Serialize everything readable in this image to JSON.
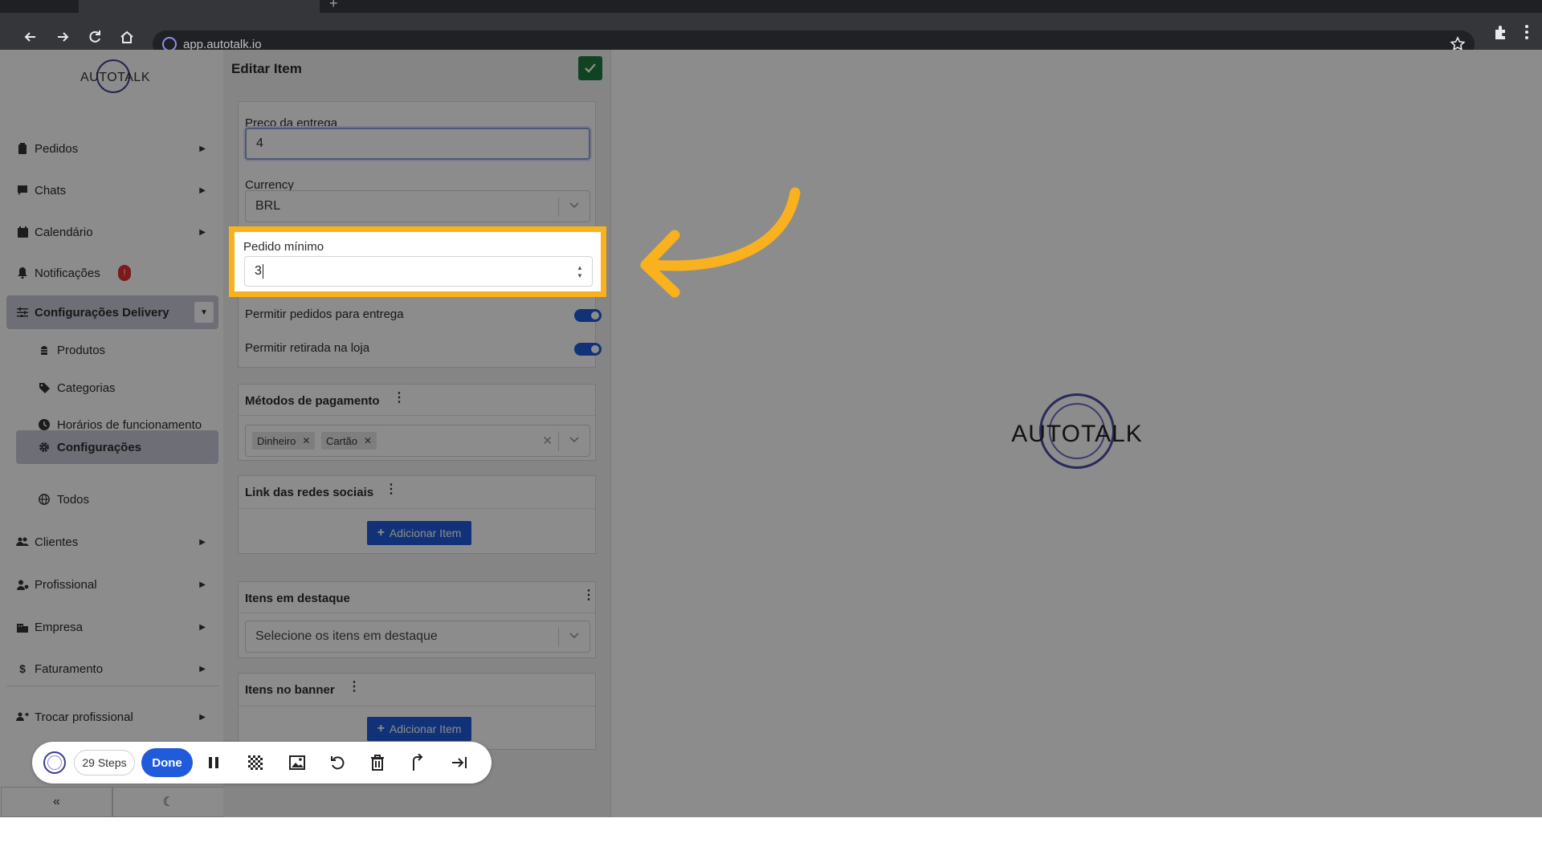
{
  "browser": {
    "url": "app.autotalk.io",
    "tab_add": "+"
  },
  "sidebar": {
    "logo_text": "AUTOTALK",
    "items": [
      {
        "label": "Pedidos",
        "icon": "clipboard-icon"
      },
      {
        "label": "Chats",
        "icon": "chat-icon"
      },
      {
        "label": "Calendário",
        "icon": "calendar-icon"
      },
      {
        "label": "Notificações",
        "icon": "bell-icon",
        "badge": "!"
      },
      {
        "label": "Configurações Delivery",
        "icon": "sliders-icon"
      },
      {
        "label": "Clientes",
        "icon": "users-icon"
      },
      {
        "label": "Profissional",
        "icon": "user-gear-icon"
      },
      {
        "label": "Empresa",
        "icon": "building-icon"
      },
      {
        "label": "Faturamento",
        "icon": "dollar-icon"
      },
      {
        "label": "Trocar profissional",
        "icon": "users-swap-icon"
      }
    ],
    "subitems": [
      {
        "label": "Produtos",
        "icon": "hamburger-icon"
      },
      {
        "label": "Categorias",
        "icon": "tag-icon"
      },
      {
        "label": "Horários de funcionamento",
        "icon": "clock-icon"
      },
      {
        "label": "Configurações",
        "icon": "gear-icon"
      },
      {
        "label": "Todos",
        "icon": "globe-icon"
      }
    ],
    "collapse_label": "«",
    "theme_label": "☾"
  },
  "editor": {
    "title": "Editar Item",
    "preco_label": "Preço da entrega",
    "preco_value": "4",
    "currency_label": "Currency",
    "currency_value": "BRL",
    "pedido_label": "Pedido mínimo",
    "pedido_value": "3",
    "toggle_entrega_label": "Permitir pedidos para entrega",
    "toggle_entrega_on": true,
    "toggle_retirada_label": "Permitir retirada na loja",
    "toggle_retirada_on": true,
    "pagamento_title": "Métodos de pagamento",
    "pagamento_chips": [
      "Dinheiro",
      "Cartão"
    ],
    "redes_title": "Link das redes sociais",
    "add_item_label": "Adicionar Item",
    "destaque_title": "Itens em destaque",
    "destaque_placeholder": "Selecione os itens em destaque",
    "banner_title": "Itens no banner"
  },
  "content": {
    "logo_text": "AUTOTALK"
  },
  "recorder": {
    "steps_label": "29 Steps",
    "done_label": "Done"
  },
  "colors": {
    "accent": "#1f5bdb",
    "highlight": "#f9b21e",
    "save": "#1e7a3c",
    "badge": "#e0312f"
  }
}
